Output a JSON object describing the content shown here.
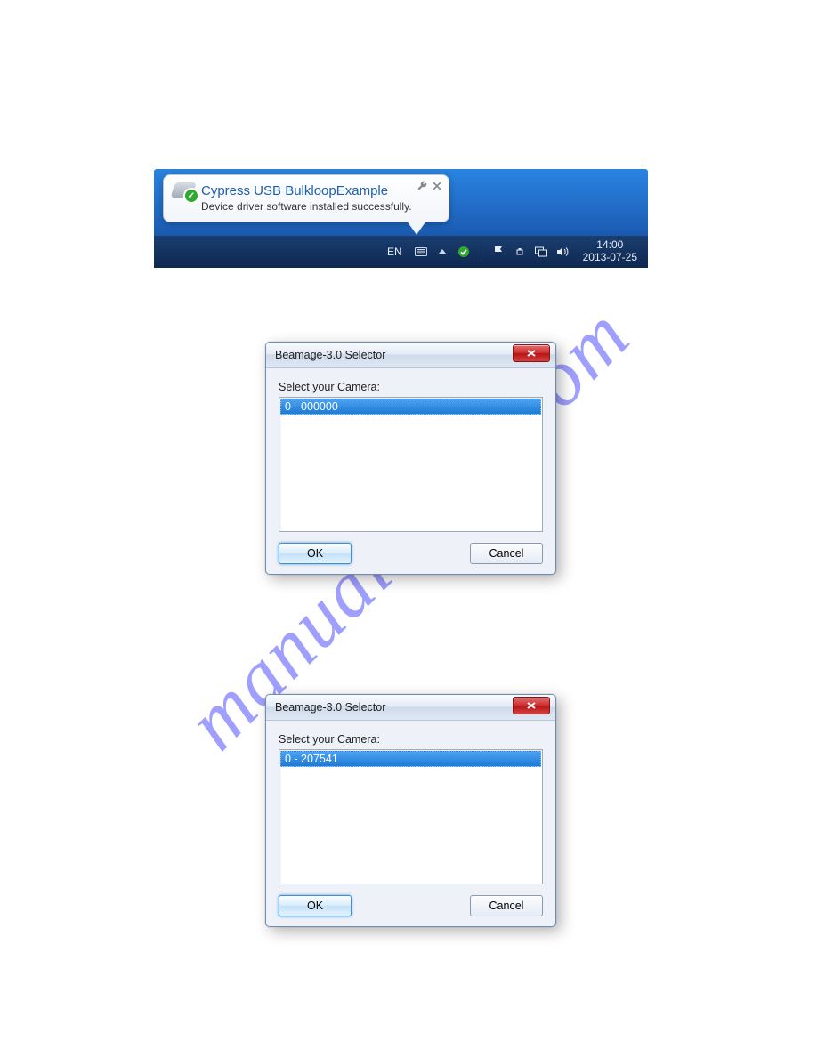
{
  "watermark": "manualshive.com",
  "notification": {
    "title": "Cypress USB BulkloopExample",
    "subtitle": "Device driver software installed successfully."
  },
  "taskbar": {
    "language": "EN",
    "time": "14:00",
    "date": "2013-07-25"
  },
  "dialog1": {
    "title": "Beamage-3.0 Selector",
    "label": "Select your Camera:",
    "item": "0 - 000000",
    "ok": "OK",
    "cancel": "Cancel"
  },
  "dialog2": {
    "title": "Beamage-3.0 Selector",
    "label": "Select your Camera:",
    "item": "0 - 207541",
    "ok": "OK",
    "cancel": "Cancel"
  }
}
